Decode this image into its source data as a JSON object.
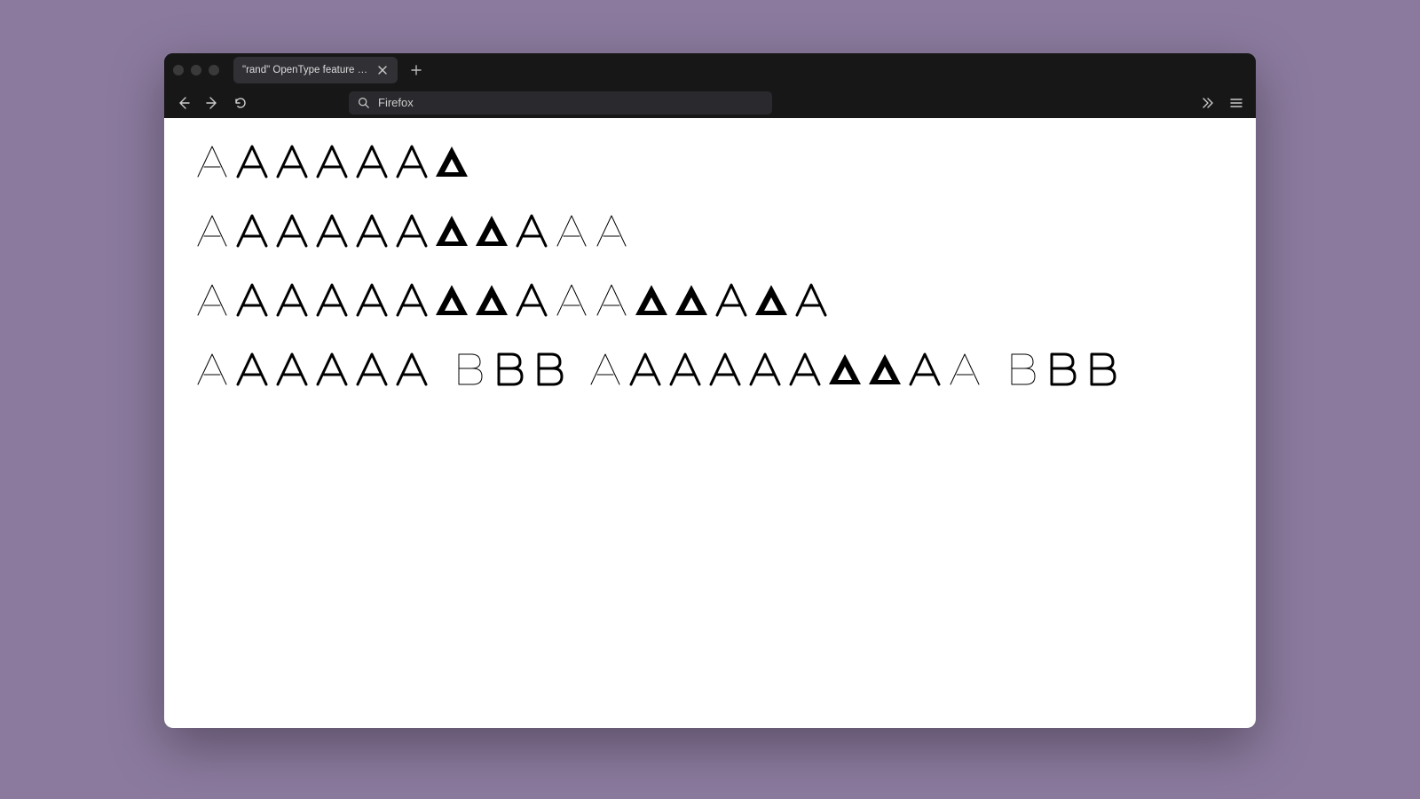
{
  "browser": {
    "tab_title": "\"rand\" OpenType feature test",
    "address_text": "Firefox"
  },
  "glyph_size": 40,
  "rows": [
    [
      {
        "ch": "A",
        "w": 1
      },
      {
        "ch": "A",
        "w": 3
      },
      {
        "ch": "A",
        "w": 3
      },
      {
        "ch": "A",
        "w": 3
      },
      {
        "ch": "A",
        "w": 3
      },
      {
        "ch": "A",
        "w": 3
      },
      {
        "ch": "A",
        "w": 6
      }
    ],
    [
      {
        "ch": "A",
        "w": 1
      },
      {
        "ch": "A",
        "w": 3
      },
      {
        "ch": "A",
        "w": 3
      },
      {
        "ch": "A",
        "w": 3
      },
      {
        "ch": "A",
        "w": 3
      },
      {
        "ch": "A",
        "w": 3
      },
      {
        "ch": "A",
        "w": 6
      },
      {
        "ch": "A",
        "w": 6
      },
      {
        "ch": "A",
        "w": 3
      },
      {
        "ch": "A",
        "w": 1
      },
      {
        "ch": "A",
        "w": 1
      }
    ],
    [
      {
        "ch": "A",
        "w": 1
      },
      {
        "ch": "A",
        "w": 3
      },
      {
        "ch": "A",
        "w": 3
      },
      {
        "ch": "A",
        "w": 3
      },
      {
        "ch": "A",
        "w": 3
      },
      {
        "ch": "A",
        "w": 3
      },
      {
        "ch": "A",
        "w": 6
      },
      {
        "ch": "A",
        "w": 6
      },
      {
        "ch": "A",
        "w": 3
      },
      {
        "ch": "A",
        "w": 1
      },
      {
        "ch": "A",
        "w": 1
      },
      {
        "ch": "A",
        "w": 6
      },
      {
        "ch": "A",
        "w": 6
      },
      {
        "ch": "A",
        "w": 3
      },
      {
        "ch": "A",
        "w": 6
      },
      {
        "ch": "A",
        "w": 3
      }
    ],
    [
      {
        "ch": "A",
        "w": 1
      },
      {
        "ch": "A",
        "w": 3
      },
      {
        "ch": "A",
        "w": 3
      },
      {
        "ch": "A",
        "w": 3
      },
      {
        "ch": "A",
        "w": 3
      },
      {
        "ch": "A",
        "w": 3
      },
      {
        "ch": "gap"
      },
      {
        "ch": "B",
        "w": 1
      },
      {
        "ch": "B",
        "w": 3
      },
      {
        "ch": "B",
        "w": 3
      },
      {
        "ch": "gap"
      },
      {
        "ch": "A",
        "w": 1
      },
      {
        "ch": "A",
        "w": 3
      },
      {
        "ch": "A",
        "w": 3
      },
      {
        "ch": "A",
        "w": 3
      },
      {
        "ch": "A",
        "w": 3
      },
      {
        "ch": "A",
        "w": 3
      },
      {
        "ch": "A",
        "w": 6
      },
      {
        "ch": "A",
        "w": 6
      },
      {
        "ch": "A",
        "w": 3
      },
      {
        "ch": "A",
        "w": 1
      },
      {
        "ch": "gap"
      },
      {
        "ch": "B",
        "w": 1
      },
      {
        "ch": "B",
        "w": 3
      },
      {
        "ch": "B",
        "w": 3
      }
    ]
  ]
}
